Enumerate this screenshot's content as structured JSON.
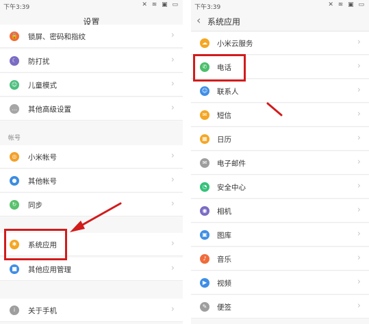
{
  "colors": {
    "highlight": "#d21b1b",
    "arrow": "#d21b1b",
    "chevron": "#c8c8c8"
  },
  "left": {
    "status_time": "下午3:39",
    "status_icons": "✕ ≋ ▣ ▭",
    "title": "设置",
    "section_label": "帐号",
    "items": [
      {
        "label": "锁屏、密码和指纹",
        "icon": "lock-icon",
        "color": "#f06b3b",
        "glyph": "🔒"
      },
      {
        "label": "防打扰",
        "icon": "moon-icon",
        "color": "#7b6cc4",
        "glyph": "☾"
      },
      {
        "label": "儿童模式",
        "icon": "child-icon",
        "color": "#4cbf7e",
        "glyph": "☺"
      },
      {
        "label": "其他高级设置",
        "icon": "more-icon",
        "color": "#a6a6a6",
        "glyph": "…"
      },
      {
        "label": "小米帐号",
        "icon": "mi-account-icon",
        "color": "#f3a02a",
        "glyph": "◎"
      },
      {
        "label": "其他帐号",
        "icon": "person-icon",
        "color": "#3c8de0",
        "glyph": "●"
      },
      {
        "label": "同步",
        "icon": "sync-icon",
        "color": "#58c26c",
        "glyph": "↻"
      },
      {
        "label": "系统应用",
        "icon": "apps-icon",
        "color": "#f5a623",
        "glyph": "✱"
      },
      {
        "label": "其他应用管理",
        "icon": "app-manage-icon",
        "color": "#3f8ee6",
        "glyph": "■"
      },
      {
        "label": "关于手机",
        "icon": "phone-info-icon",
        "color": "#9e9e9e",
        "glyph": "i"
      }
    ]
  },
  "right": {
    "status_time": "下午3:39",
    "status_icons": "✕ ≋ ▣ ▭",
    "back_glyph": "‹",
    "title": "系统应用",
    "items": [
      {
        "label": "小米云服务",
        "icon": "cloud-icon",
        "color": "#f5a623",
        "glyph": "☁"
      },
      {
        "label": "电话",
        "icon": "phone-icon",
        "color": "#4bbf6b",
        "glyph": "✆"
      },
      {
        "label": "联系人",
        "icon": "contacts-icon",
        "color": "#3f8ee6",
        "glyph": "☺"
      },
      {
        "label": "短信",
        "icon": "message-icon",
        "color": "#f5a623",
        "glyph": "✉"
      },
      {
        "label": "日历",
        "icon": "calendar-icon",
        "color": "#f5a623",
        "glyph": "▦"
      },
      {
        "label": "电子邮件",
        "icon": "email-icon",
        "color": "#9e9e9e",
        "glyph": "✉"
      },
      {
        "label": "安全中心",
        "icon": "security-icon",
        "color": "#34c27a",
        "glyph": "◔"
      },
      {
        "label": "相机",
        "icon": "camera-icon",
        "color": "#7b6cc4",
        "glyph": "◉"
      },
      {
        "label": "图库",
        "icon": "gallery-icon",
        "color": "#3f8ee6",
        "glyph": "▣"
      },
      {
        "label": "音乐",
        "icon": "music-icon",
        "color": "#f06b3b",
        "glyph": "♪"
      },
      {
        "label": "视频",
        "icon": "video-icon",
        "color": "#3f8ee6",
        "glyph": "▶"
      },
      {
        "label": "便签",
        "icon": "notes-icon",
        "color": "#9e9e9e",
        "glyph": "✎"
      }
    ]
  }
}
